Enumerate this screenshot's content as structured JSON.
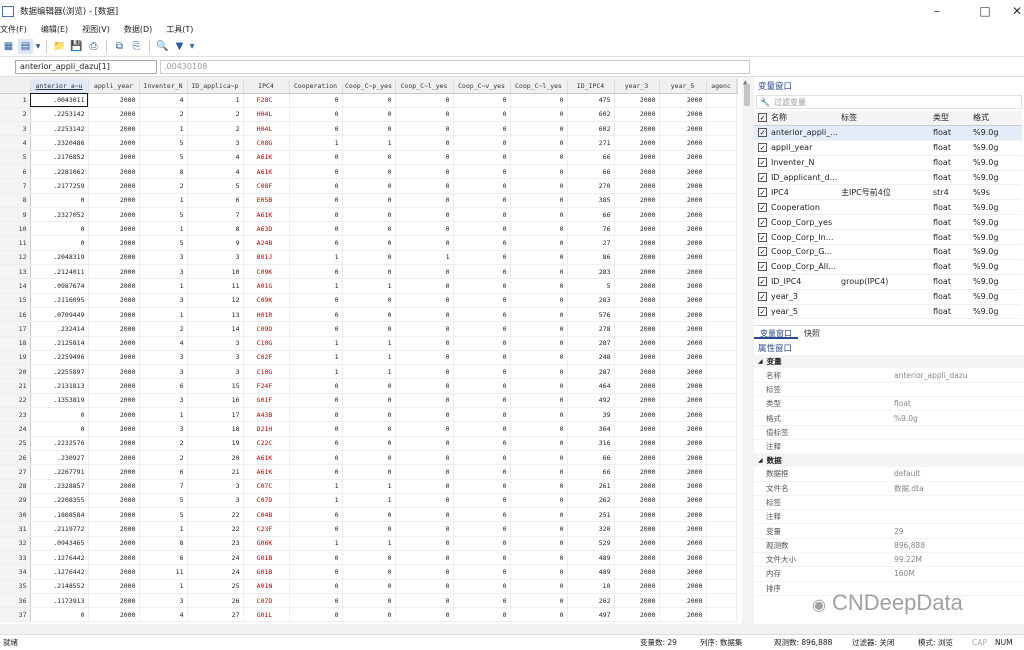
{
  "window": {
    "title": "数据编辑器(浏览) - [数据]"
  },
  "menu": [
    "文件(F)",
    "编辑(E)",
    "视图(V)",
    "数据(D)",
    "工具(T)"
  ],
  "formula": {
    "cell_ref": "anterior_appli_dazu[1]",
    "value": ".00430108"
  },
  "grid": {
    "columns": [
      "anterior_a~u",
      "appli_year",
      "Inventer_N",
      "ID_applica~p",
      "IPC4",
      "Cooperation",
      "Coop_C~p_yes",
      "Coop_C~l_yes",
      "Coop_C~v_yes",
      "Coop_C~l_yes",
      "ID_IPC4",
      "year_3",
      "year_5",
      "agenc"
    ],
    "rows": [
      [
        "1",
        ".0043011",
        "2000",
        "4",
        "1",
        "F28C",
        "0",
        "0",
        "0",
        "0",
        "0",
        "475",
        "2000",
        "2000"
      ],
      [
        "2",
        ".2253142",
        "2000",
        "2",
        "2",
        "H04L",
        "0",
        "0",
        "0",
        "0",
        "0",
        "602",
        "2000",
        "2000"
      ],
      [
        "3",
        ".2253142",
        "2000",
        "1",
        "2",
        "H04L",
        "0",
        "0",
        "0",
        "0",
        "0",
        "602",
        "2000",
        "2000"
      ],
      [
        "4",
        ".2320486",
        "2000",
        "5",
        "3",
        "C08G",
        "1",
        "1",
        "0",
        "0",
        "0",
        "271",
        "2000",
        "2000"
      ],
      [
        "5",
        ".2176852",
        "2000",
        "5",
        "4",
        "A61K",
        "0",
        "0",
        "0",
        "0",
        "0",
        "66",
        "2000",
        "2000"
      ],
      [
        "6",
        ".2281062",
        "2000",
        "8",
        "4",
        "A61K",
        "0",
        "0",
        "0",
        "0",
        "0",
        "66",
        "2000",
        "2000"
      ],
      [
        "7",
        ".2177259",
        "2000",
        "2",
        "5",
        "C08F",
        "0",
        "0",
        "0",
        "0",
        "0",
        "270",
        "2000",
        "2000"
      ],
      [
        "8",
        "0",
        "2000",
        "1",
        "6",
        "E05B",
        "0",
        "0",
        "0",
        "0",
        "0",
        "385",
        "2000",
        "2000"
      ],
      [
        "9",
        ".2327052",
        "2000",
        "5",
        "7",
        "A61K",
        "0",
        "0",
        "0",
        "0",
        "0",
        "66",
        "2000",
        "2000"
      ],
      [
        "10",
        "0",
        "2000",
        "1",
        "8",
        "A63D",
        "0",
        "0",
        "0",
        "0",
        "0",
        "76",
        "2000",
        "2000"
      ],
      [
        "11",
        "0",
        "2000",
        "5",
        "9",
        "A24B",
        "0",
        "0",
        "0",
        "0",
        "0",
        "27",
        "2000",
        "2000"
      ],
      [
        "12",
        ".2048319",
        "2000",
        "3",
        "3",
        "B01J",
        "1",
        "0",
        "1",
        "0",
        "0",
        "86",
        "2000",
        "2000"
      ],
      [
        "13",
        ".2124011",
        "2000",
        "3",
        "10",
        "C09K",
        "0",
        "0",
        "0",
        "0",
        "0",
        "283",
        "2000",
        "2000"
      ],
      [
        "14",
        ".0987674",
        "2000",
        "1",
        "11",
        "A01G",
        "1",
        "1",
        "0",
        "0",
        "0",
        "5",
        "2000",
        "2000"
      ],
      [
        "15",
        ".2116095",
        "2000",
        "3",
        "12",
        "C09K",
        "0",
        "0",
        "0",
        "0",
        "0",
        "283",
        "2000",
        "2000"
      ],
      [
        "16",
        ".0709449",
        "2000",
        "1",
        "13",
        "H01R",
        "0",
        "0",
        "0",
        "0",
        "0",
        "576",
        "2000",
        "2000"
      ],
      [
        "17",
        ".232414",
        "2000",
        "2",
        "14",
        "C09D",
        "0",
        "0",
        "0",
        "0",
        "0",
        "278",
        "2000",
        "2000"
      ],
      [
        "18",
        ".2125814",
        "2000",
        "4",
        "3",
        "C10G",
        "1",
        "1",
        "0",
        "0",
        "0",
        "287",
        "2000",
        "2000"
      ],
      [
        "19",
        ".2259496",
        "2000",
        "3",
        "3",
        "C02F",
        "1",
        "1",
        "0",
        "0",
        "0",
        "248",
        "2000",
        "2000"
      ],
      [
        "20",
        ".2255897",
        "2000",
        "3",
        "3",
        "C10G",
        "1",
        "1",
        "0",
        "0",
        "0",
        "287",
        "2000",
        "2000"
      ],
      [
        "21",
        ".2131813",
        "2000",
        "6",
        "15",
        "F24F",
        "0",
        "0",
        "0",
        "0",
        "0",
        "464",
        "2000",
        "2000"
      ],
      [
        "22",
        ".1353819",
        "2000",
        "3",
        "16",
        "G01F",
        "0",
        "0",
        "0",
        "0",
        "0",
        "492",
        "2000",
        "2000"
      ],
      [
        "23",
        "0",
        "2000",
        "1",
        "17",
        "A43B",
        "0",
        "0",
        "0",
        "0",
        "0",
        "39",
        "2000",
        "2000"
      ],
      [
        "24",
        "0",
        "2000",
        "3",
        "18",
        "D21H",
        "0",
        "0",
        "0",
        "0",
        "0",
        "364",
        "2000",
        "2000"
      ],
      [
        "25",
        ".2232576",
        "2000",
        "2",
        "19",
        "C22C",
        "0",
        "0",
        "0",
        "0",
        "0",
        "316",
        "2000",
        "2000"
      ],
      [
        "26",
        ".230927",
        "2000",
        "2",
        "20",
        "A61K",
        "0",
        "0",
        "0",
        "0",
        "0",
        "66",
        "2000",
        "2000"
      ],
      [
        "27",
        ".2267791",
        "2000",
        "6",
        "21",
        "A61K",
        "0",
        "0",
        "0",
        "0",
        "0",
        "66",
        "2000",
        "2000"
      ],
      [
        "28",
        ".2328857",
        "2000",
        "7",
        "3",
        "C07C",
        "1",
        "1",
        "0",
        "0",
        "0",
        "261",
        "2000",
        "2000"
      ],
      [
        "29",
        ".2208355",
        "2000",
        "5",
        "3",
        "C07D",
        "1",
        "1",
        "0",
        "0",
        "0",
        "262",
        "2000",
        "2000"
      ],
      [
        "30",
        ".1808584",
        "2000",
        "5",
        "22",
        "C04B",
        "0",
        "0",
        "0",
        "0",
        "0",
        "251",
        "2000",
        "2000"
      ],
      [
        "31",
        ".2119772",
        "2000",
        "1",
        "22",
        "C23F",
        "0",
        "0",
        "0",
        "0",
        "0",
        "320",
        "2000",
        "2000"
      ],
      [
        "32",
        ".0943465",
        "2000",
        "8",
        "23",
        "G06K",
        "1",
        "1",
        "0",
        "0",
        "0",
        "529",
        "2000",
        "2000"
      ],
      [
        "33",
        ".1276442",
        "2000",
        "6",
        "24",
        "G01B",
        "0",
        "0",
        "0",
        "0",
        "0",
        "489",
        "2000",
        "2000"
      ],
      [
        "34",
        ".1276442",
        "2000",
        "11",
        "24",
        "G01B",
        "0",
        "0",
        "0",
        "0",
        "0",
        "489",
        "2000",
        "2000"
      ],
      [
        "35",
        ".2148552",
        "2000",
        "1",
        "25",
        "A01N",
        "0",
        "0",
        "0",
        "0",
        "0",
        "10",
        "2000",
        "2000"
      ],
      [
        "36",
        ".1173913",
        "2000",
        "3",
        "26",
        "C07D",
        "0",
        "0",
        "0",
        "0",
        "0",
        "262",
        "2000",
        "2000"
      ],
      [
        "37",
        "0",
        "2000",
        "4",
        "27",
        "G01L",
        "0",
        "0",
        "0",
        "0",
        "0",
        "497",
        "2000",
        "2000"
      ]
    ]
  },
  "var_panel": {
    "title": "变量窗口",
    "filter_placeholder": "过滤变量",
    "headers": [
      "名称",
      "标签",
      "类型",
      "格式"
    ],
    "vars": [
      [
        "anterior_appli_...",
        "",
        "float",
        "%9.0g"
      ],
      [
        "appli_year",
        "",
        "float",
        "%9.0g"
      ],
      [
        "Inventer_N",
        "",
        "float",
        "%9.0g"
      ],
      [
        "ID_applicant_d...",
        "",
        "float",
        "%9.0g"
      ],
      [
        "IPC4",
        "主IPC号前4位",
        "str4",
        "%9s"
      ],
      [
        "Cooperation",
        "",
        "float",
        "%9.0g"
      ],
      [
        "Coop_Corp_yes",
        "",
        "float",
        "%9.0g"
      ],
      [
        "Coop_Corp_In...",
        "",
        "float",
        "%9.0g"
      ],
      [
        "Coop_Corp_G...",
        "",
        "float",
        "%9.0g"
      ],
      [
        "Coop_Corp_All...",
        "",
        "float",
        "%9.0g"
      ],
      [
        "ID_IPC4",
        "group(IPC4)",
        "float",
        "%9.0g"
      ],
      [
        "year_3",
        "",
        "float",
        "%9.0g"
      ],
      [
        "year_5",
        "",
        "float",
        "%9.0g"
      ]
    ],
    "tabs": [
      "变量窗口",
      "快照"
    ]
  },
  "props_panel": {
    "title": "属性窗口",
    "sec_var": "变量",
    "var_props": [
      [
        "名称",
        "anterior_appli_dazu"
      ],
      [
        "标签",
        ""
      ],
      [
        "类型",
        "float"
      ],
      [
        "格式",
        "%9.0g"
      ],
      [
        "值标签",
        ""
      ],
      [
        "注释",
        ""
      ]
    ],
    "sec_data": "数据",
    "data_props": [
      [
        "数据框",
        "default"
      ],
      [
        "文件名",
        "数据.dta"
      ],
      [
        "标签",
        ""
      ],
      [
        "注释",
        ""
      ],
      [
        "变量",
        "29"
      ],
      [
        "观测数",
        "896,888"
      ],
      [
        "文件大小",
        "99.22M"
      ],
      [
        "内存",
        "160M"
      ],
      [
        "排序",
        ""
      ]
    ]
  },
  "status": {
    "left": "就绪",
    "vars": "变量数: 29",
    "order": "列序: 数据集",
    "obs": "观测数: 896,888",
    "filter": "过滤器: 关闭",
    "mode": "模式: 浏览",
    "cap": "CAP",
    "num": "NUM"
  },
  "watermark": "CNDeepData"
}
